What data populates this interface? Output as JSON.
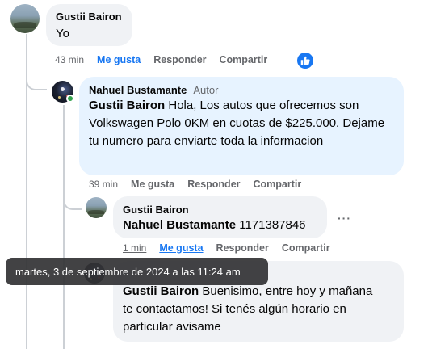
{
  "comments": [
    {
      "author": "Gustii Bairon",
      "text": "Yo",
      "time": "43 min",
      "like_label": "Me gusta",
      "reply_label": "Responder",
      "share_label": "Compartir"
    },
    {
      "author": "Nahuel Bustamante",
      "badge": "Autor",
      "mention": "Gustii Bairon",
      "text": " Hola, Los autos que ofrecemos son Volkswagen Polo 0KM en cuotas de $225.000. Dejame tu numero para enviarte toda la informacion",
      "time": "39 min",
      "like_label": "Me gusta",
      "reply_label": "Responder",
      "share_label": "Compartir"
    },
    {
      "author": "Gustii Bairon",
      "mention": "Nahuel Bustamante",
      "text": " 1171387846",
      "time": "1 min",
      "like_label": "Me gusta",
      "reply_label": "Responder",
      "share_label": "Compartir"
    },
    {
      "mention": "Gustii Bairon",
      "text": " Buenisimo, entre hoy y mañana te contactamos! Si tenés algún horario en particular avisame"
    }
  ],
  "more_label": "···",
  "tooltip": "martes, 3 de septiembre de 2024 a las 11:24 am",
  "colors": {
    "like_blue": "#1877f2",
    "bubble_gray": "#f0f2f5",
    "bubble_blue": "#e7f3ff",
    "online": "#31a24c"
  },
  "icons": {
    "like_reaction": "thumbs-up-icon",
    "more": "more-options-icon"
  }
}
